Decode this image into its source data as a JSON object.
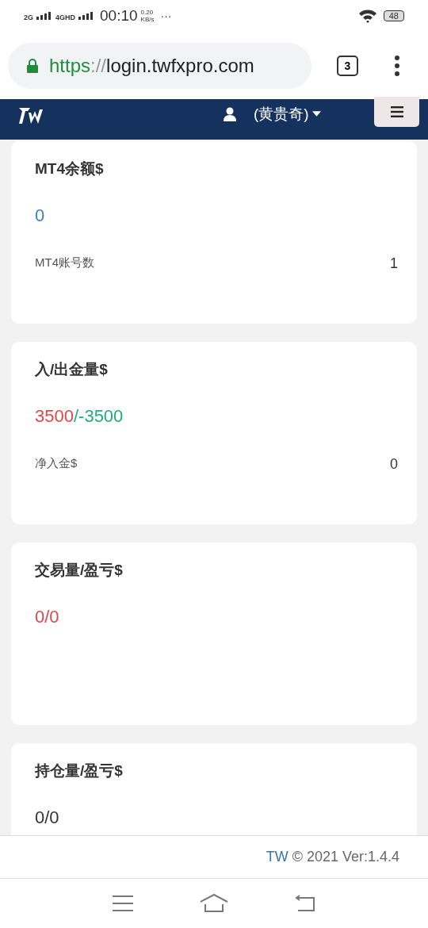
{
  "status_bar": {
    "signal_1": "2G",
    "signal_2": "4GHD",
    "time": "00:10",
    "speed_value": "0.20",
    "speed_unit": "KB/s",
    "more": "···",
    "battery": "48"
  },
  "browser": {
    "url_scheme": "https",
    "url_separator": "://",
    "url_host": "login.twfxpro.com",
    "tab_count": "3"
  },
  "navbar": {
    "user": "(黄贵奇)"
  },
  "cards": [
    {
      "title": "MT4余额$",
      "value": [
        {
          "text": "0",
          "kind": "balance"
        }
      ],
      "detail": {
        "label": "MT4账号数",
        "value": "1"
      }
    },
    {
      "title": "入/出金量$",
      "value": [
        {
          "text": "3500",
          "kind": "loss"
        },
        {
          "text": "/-3500",
          "kind": "gain"
        }
      ],
      "detail": {
        "label": "净入金$",
        "value": "0"
      }
    },
    {
      "title": "交易量/盈亏$",
      "value": [
        {
          "text": "0/0",
          "kind": "loss"
        }
      ]
    },
    {
      "title": "持仓量/盈亏$",
      "value": [
        {
          "text": "0/0",
          "kind": "plain"
        }
      ]
    }
  ],
  "footer": {
    "brand": "TW",
    "text": "© 2021 Ver:1.4.4"
  }
}
